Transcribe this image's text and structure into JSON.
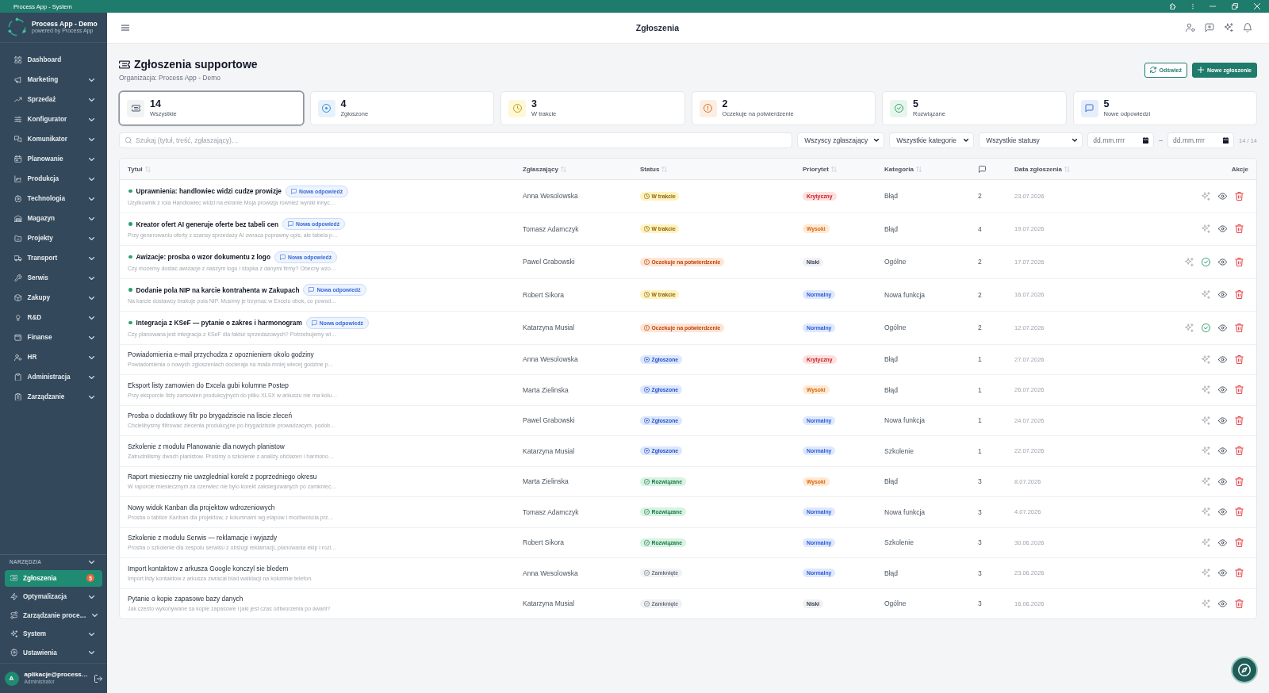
{
  "window": {
    "title": "Process App - System"
  },
  "sidebar": {
    "app_name": "Process App - Demo",
    "app_tagline": "powered by Process App",
    "items": [
      {
        "label": "Dashboard",
        "has_submenu": false
      },
      {
        "label": "Marketing",
        "has_submenu": true
      },
      {
        "label": "Sprzedaż",
        "has_submenu": true
      },
      {
        "label": "Konfigurator",
        "has_submenu": true
      },
      {
        "label": "Komunikator",
        "has_submenu": true
      },
      {
        "label": "Planowanie",
        "has_submenu": true
      },
      {
        "label": "Produkcja",
        "has_submenu": true
      },
      {
        "label": "Technologia",
        "has_submenu": true
      },
      {
        "label": "Magazyn",
        "has_submenu": true
      },
      {
        "label": "Projekty",
        "has_submenu": true
      },
      {
        "label": "Transport",
        "has_submenu": true
      },
      {
        "label": "Serwis",
        "has_submenu": true
      },
      {
        "label": "Zakupy",
        "has_submenu": true
      },
      {
        "label": "R&D",
        "has_submenu": true
      },
      {
        "label": "Finanse",
        "has_submenu": true
      },
      {
        "label": "HR",
        "has_submenu": true
      },
      {
        "label": "Administracja",
        "has_submenu": true
      },
      {
        "label": "Zarządzanie",
        "has_submenu": true
      }
    ],
    "tools": {
      "heading": "NARZĘDZIA",
      "items": [
        {
          "label": "Zgłoszenia",
          "selected": true,
          "has_submenu": false,
          "badge": "5"
        },
        {
          "label": "Optymalizacja",
          "selected": false,
          "has_submenu": true
        },
        {
          "label": "Zarządzanie proce…",
          "selected": false,
          "has_submenu": true
        },
        {
          "label": "System",
          "selected": false,
          "has_submenu": true
        },
        {
          "label": "Ustawienia",
          "selected": false,
          "has_submenu": true
        }
      ]
    },
    "user": {
      "initial": "A",
      "name": "aplikacje@process…",
      "role": "Administrator"
    }
  },
  "header": {
    "title": "Zgłoszenia"
  },
  "page": {
    "title": "Zgłoszenia supportowe",
    "subtitle": "Organizacja: Process App - Demo",
    "buttons": [
      {
        "label": "Odśwież",
        "kind": "outline"
      },
      {
        "label": "Nowe zgłoszenie",
        "kind": "primary"
      }
    ]
  },
  "stats": [
    {
      "value": "14",
      "label": "Wszystkie",
      "kind": "all",
      "selected": true
    },
    {
      "value": "4",
      "label": "Zgłoszone",
      "kind": "reported",
      "selected": false
    },
    {
      "value": "3",
      "label": "W trakcie",
      "kind": "in_progress",
      "selected": false
    },
    {
      "value": "2",
      "label": "Oczekuje na potwierdzenie",
      "kind": "pending",
      "selected": false
    },
    {
      "value": "5",
      "label": "Rozwiązane",
      "kind": "resolved",
      "selected": false
    },
    {
      "value": "5",
      "label": "Nowe odpowiedzi",
      "kind": "replies",
      "selected": false
    }
  ],
  "filters": {
    "search": {
      "placeholder": "Szukaj (tytuł, treść, zgłaszający)…"
    },
    "selects": [
      {
        "value": "Wszyscy zgłaszający"
      },
      {
        "value": "Wszystkie kategorie"
      },
      {
        "value": "Wszystkie statusy"
      }
    ],
    "date_from": {
      "placeholder": "dd.mm.rrrr"
    },
    "separator": "–",
    "date_to": {
      "placeholder": "dd.mm.rrrr"
    },
    "count": "14 / 14"
  },
  "table": {
    "columns": [
      {
        "kind": "text",
        "label": "Tytuł",
        "sortable": true
      },
      {
        "kind": "text",
        "label": "Zgłaszający",
        "sortable": true
      },
      {
        "kind": "text",
        "label": "Status",
        "sortable": true
      },
      {
        "kind": "text",
        "label": "Priorytet",
        "sortable": true
      },
      {
        "kind": "text",
        "label": "Kategoria",
        "sortable": true
      },
      {
        "kind": "comments_icon"
      },
      {
        "kind": "text",
        "label": "Data zgłoszenia",
        "sortable": true
      },
      {
        "kind": "text",
        "label": "Akcje",
        "sortable": false
      }
    ],
    "rows": [
      {
        "title": "Uprawnienia: handlowiec widzi cudze prowizje",
        "unread": true,
        "badge": "Nowa odpowiedź",
        "snippet": "Uzytkownik z rola Handlowiec widzi na ekranie Moja prowizja rowniez wyniki innyc…",
        "reporter": "Anna Wesolowska",
        "status": {
          "label": "W trakcie",
          "kind": "in_progress"
        },
        "priority": {
          "label": "Krytyczny",
          "kind": "critical"
        },
        "category": "Błąd",
        "comments": "2",
        "date": "23.07.2026",
        "confirmable": false
      },
      {
        "title": "Kreator ofert AI generuje oferte bez tabeli cen",
        "unread": true,
        "badge": "Nowa odpowiedź",
        "snippet": "Przy generowaniu oferty z szansy sprzedazy AI zwraca poprawny opis, ale tabela p…",
        "reporter": "Tomasz Adamczyk",
        "status": {
          "label": "W trakcie",
          "kind": "in_progress"
        },
        "priority": {
          "label": "Wysoki",
          "kind": "high"
        },
        "category": "Błąd",
        "comments": "4",
        "date": "19.07.2026",
        "confirmable": false
      },
      {
        "title": "Awizacje: prosba o wzor dokumentu z logo",
        "unread": true,
        "badge": "Nowa odpowiedź",
        "snippet": "Czy mozemy dostac awizacje z naszym logo i stopka z danymi firmy? Obecny wzo…",
        "reporter": "Pawel Grabowski",
        "status": {
          "label": "Oczekuje na potwierdzenie",
          "kind": "pending"
        },
        "priority": {
          "label": "Niski",
          "kind": "low"
        },
        "category": "Ogólne",
        "comments": "2",
        "date": "17.07.2026",
        "confirmable": true
      },
      {
        "title": "Dodanie pola NIP na karcie kontrahenta w Zakupach",
        "unread": true,
        "badge": "Nowa odpowiedź",
        "snippet": "Na karcie dostawcy brakuje pola NIP. Musimy je trzymac w Excelu obok, co powod…",
        "reporter": "Robert Sikora",
        "status": {
          "label": "W trakcie",
          "kind": "in_progress"
        },
        "priority": {
          "label": "Normalny",
          "kind": "normal"
        },
        "category": "Nowa funkcja",
        "comments": "2",
        "date": "16.07.2026",
        "confirmable": false
      },
      {
        "title": "Integracja z KSeF — pytanie o zakres i harmonogram",
        "unread": true,
        "badge": "Nowa odpowiedź",
        "snippet": "Czy planowana jest integracja z KSeF dla faktur sprzedazowych? Potrzebujemy wi…",
        "reporter": "Katarzyna Musial",
        "status": {
          "label": "Oczekuje na potwierdzenie",
          "kind": "pending"
        },
        "priority": {
          "label": "Normalny",
          "kind": "normal"
        },
        "category": "Ogólne",
        "comments": "2",
        "date": "12.07.2026",
        "confirmable": true
      },
      {
        "title": "Powiadomienia e-mail przychodza z opoznieniem okolo godziny",
        "unread": false,
        "snippet": "Powiadomienia o nowych zgloszeniach docieraja na maila mniej wiecej godzine p…",
        "reporter": "Anna Wesolowska",
        "status": {
          "label": "Zgłoszone",
          "kind": "reported"
        },
        "priority": {
          "label": "Krytyczny",
          "kind": "critical"
        },
        "category": "Błąd",
        "comments": "1",
        "date": "27.07.2026",
        "confirmable": false
      },
      {
        "title": "Eksport listy zamowien do Excela gubi kolumne Postep",
        "unread": false,
        "snippet": "Przy eksporcie listy zamowien produkcyjnych do pliku XLSX w arkuszu nie ma kolu…",
        "reporter": "Marta Zielinska",
        "status": {
          "label": "Zgłoszone",
          "kind": "reported"
        },
        "priority": {
          "label": "Wysoki",
          "kind": "high"
        },
        "category": "Błąd",
        "comments": "1",
        "date": "26.07.2026",
        "confirmable": false
      },
      {
        "title": "Prosba o dodatkowy filtr po brygadziscie na liscie zleceń",
        "unread": false,
        "snippet": "Chcielibysmy filtrowac zlecenia produkcyjne po brygadziscie prowadzacym, podob…",
        "reporter": "Pawel Grabowski",
        "status": {
          "label": "Zgłoszone",
          "kind": "reported"
        },
        "priority": {
          "label": "Normalny",
          "kind": "normal"
        },
        "category": "Nowa funkcja",
        "comments": "1",
        "date": "24.07.2026",
        "confirmable": false
      },
      {
        "title": "Szkolenie z modulu Planowanie dla nowych planistow",
        "unread": false,
        "snippet": "Zatrudnilismy dwoch planistow. Prosimy o szkolenie z analizy obciazen i harmono…",
        "reporter": "Katarzyna Musial",
        "status": {
          "label": "Zgłoszone",
          "kind": "reported"
        },
        "priority": {
          "label": "Normalny",
          "kind": "normal"
        },
        "category": "Szkolenie",
        "comments": "1",
        "date": "22.07.2026",
        "confirmable": false
      },
      {
        "title": "Raport miesieczny nie uwzglednial korekt z poprzedniego okresu",
        "unread": false,
        "snippet": "W raporcie miesiecznym za czerwiec nie bylo korekt zaksiegowanych po zamkniec…",
        "reporter": "Marta Zielinska",
        "status": {
          "label": "Rozwiązane",
          "kind": "resolved"
        },
        "priority": {
          "label": "Wysoki",
          "kind": "high"
        },
        "category": "Błąd",
        "comments": "3",
        "date": "8.07.2026",
        "confirmable": false
      },
      {
        "title": "Nowy widok Kanban dla projektow wdrozeniowych",
        "unread": false,
        "snippet": "Prosba o tablice Kanban dla projektow, z kolumnami wg etapow i mozliwoscia prz…",
        "reporter": "Tomasz Adamczyk",
        "status": {
          "label": "Rozwiązane",
          "kind": "resolved"
        },
        "priority": {
          "label": "Normalny",
          "kind": "normal"
        },
        "category": "Nowa funkcja",
        "comments": "3",
        "date": "4.07.2026",
        "confirmable": false
      },
      {
        "title": "Szkolenie z modulu Serwis — reklamacje i wyjazdy",
        "unread": false,
        "snippet": "Prosba o szkolenie dla zespolu serwisu z obslugi reklamacji, planowania ekip i rozl…",
        "reporter": "Robert Sikora",
        "status": {
          "label": "Rozwiązane",
          "kind": "resolved"
        },
        "priority": {
          "label": "Normalny",
          "kind": "normal"
        },
        "category": "Szkolenie",
        "comments": "3",
        "date": "30.06.2026",
        "confirmable": false
      },
      {
        "title": "Import kontaktow z arkusza Google konczyl sie bledem",
        "unread": false,
        "snippet": "Import listy kontaktow z arkusza zwracal blad walidacji na kolumnie telefon.",
        "reporter": "Anna Wesolowska",
        "status": {
          "label": "Zamknięte",
          "kind": "closed"
        },
        "priority": {
          "label": "Normalny",
          "kind": "normal"
        },
        "category": "Błąd",
        "comments": "3",
        "date": "23.06.2026",
        "confirmable": false
      },
      {
        "title": "Pytanie o kopie zapasowe bazy danych",
        "unread": false,
        "snippet": "Jak czesto wykonywane sa kopie zapasowe i jaki jest czas odtworzenia po awarii?",
        "reporter": "Katarzyna Musial",
        "status": {
          "label": "Zamknięte",
          "kind": "closed"
        },
        "priority": {
          "label": "Niski",
          "kind": "low"
        },
        "category": "Ogólne",
        "comments": "3",
        "date": "16.06.2026",
        "confirmable": false
      }
    ]
  }
}
